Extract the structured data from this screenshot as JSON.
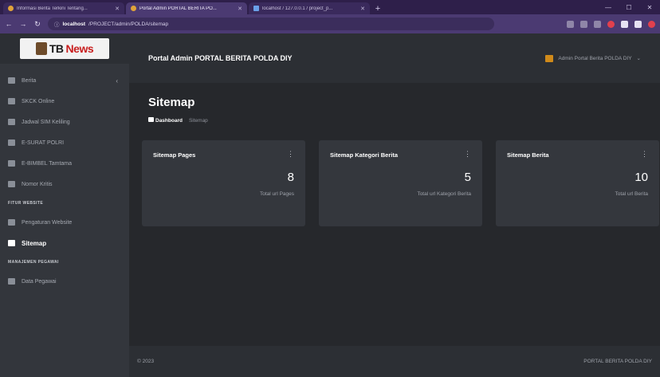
{
  "browser": {
    "tabs": [
      {
        "title": "Informasi Berita Terkini Tentang..."
      },
      {
        "title": "Portal Admin PORTAL BERITA PO..."
      },
      {
        "title": "localhost / 127.0.0.1 / project_p..."
      }
    ],
    "url_host": "localhost",
    "url_path": "/PROJECT/admin/POLDA/sitemap"
  },
  "logo": {
    "part1": "TB",
    "part2": "News"
  },
  "header": {
    "portal_title": "Portal Admin PORTAL BERITA POLDA DIY",
    "user_name": "Admin Portal Berita POLDA DIY"
  },
  "sidebar": {
    "items": [
      {
        "label": "Berita"
      },
      {
        "label": "SKCK Online"
      },
      {
        "label": "Jadwal SIM Keliling"
      },
      {
        "label": "E-SURAT POLRI"
      },
      {
        "label": "E-BIMBEL Tamtama"
      },
      {
        "label": "Nomor Kritis"
      }
    ],
    "section_website": "FITUR WEBSITE",
    "items2": [
      {
        "label": "Pengaturan Website"
      },
      {
        "label": "Sitemap"
      }
    ],
    "section_pegawai": "MANAJEMEN PEGAWAI",
    "items3": [
      {
        "label": "Data Pegawai"
      }
    ]
  },
  "page": {
    "title": "Sitemap",
    "breadcrumb_home": "Dashboard",
    "breadcrumb_current": "Sitemap"
  },
  "cards": [
    {
      "title": "Sitemap Pages",
      "value": "8",
      "subtitle": "Total url Pages"
    },
    {
      "title": "Sitemap Kategori Berita",
      "value": "5",
      "subtitle": "Total url Kategori Berita"
    },
    {
      "title": "Sitemap Berita",
      "value": "10",
      "subtitle": "Total url Berita"
    }
  ],
  "footer": {
    "left": "© 2023",
    "right": "PORTAL BERITA POLDA DIY"
  }
}
